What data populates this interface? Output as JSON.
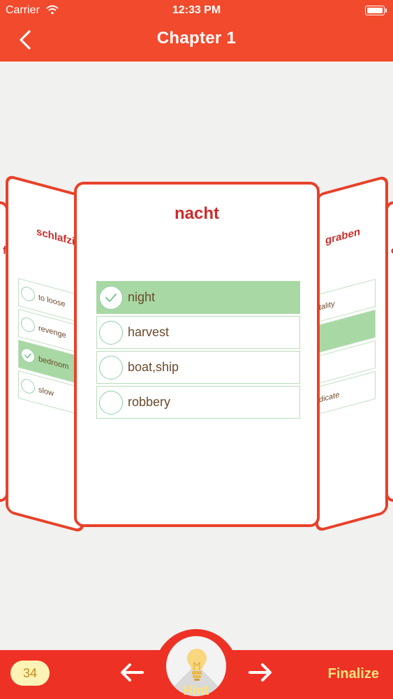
{
  "status": {
    "carrier": "Carrier",
    "time": "12:33 PM"
  },
  "header": {
    "title": "Chapter 1",
    "back_icon": "chevron-left-icon"
  },
  "main_card": {
    "word": "nacht",
    "options": [
      {
        "label": "night",
        "selected": true
      },
      {
        "label": "harvest",
        "selected": false
      },
      {
        "label": "boat,ship",
        "selected": false
      },
      {
        "label": "robbery",
        "selected": false
      }
    ]
  },
  "left_card": {
    "word": "schlafzimm",
    "options": [
      {
        "label": "to loose",
        "selected": false
      },
      {
        "label": "revenge",
        "selected": false
      },
      {
        "label": "bedroom",
        "selected": true
      },
      {
        "label": "slow",
        "selected": false
      }
    ]
  },
  "right_card": {
    "word": "graben",
    "options": [
      {
        "label": "tality",
        "selected": false
      },
      {
        "label": "",
        "selected": true
      },
      {
        "label": "",
        "selected": false
      },
      {
        "label": "dicate",
        "selected": false
      }
    ]
  },
  "far_left_card": {
    "word": "f"
  },
  "far_right_card": {
    "word": "o"
  },
  "footer": {
    "score": "34",
    "hint_label": "Hint",
    "finalize_label": "Finalize"
  },
  "colors": {
    "header_red": "#f24a2c",
    "footer_red": "#ee3125",
    "card_border": "#e8412a",
    "selected_green": "#a8d8a4",
    "word_red": "#cc2b2b",
    "accent_yellow": "#fbe27d"
  }
}
